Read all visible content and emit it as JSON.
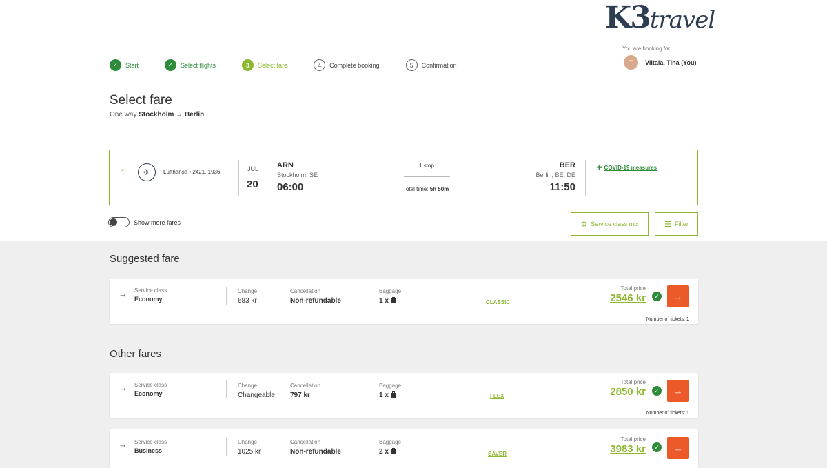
{
  "logo": {
    "k3": "K3",
    "travel": "travel"
  },
  "booking": {
    "label": "You are booking for:",
    "avatar_initial": "T",
    "user_name": "Viitala, Tina (You)"
  },
  "steps": [
    {
      "label": "Start",
      "state": "done",
      "marker": "✓"
    },
    {
      "label": "Select flights",
      "state": "done",
      "marker": "✓"
    },
    {
      "label": "Select fare",
      "state": "current",
      "marker": "3"
    },
    {
      "label": "Complete booking",
      "state": "todo",
      "marker": "4"
    },
    {
      "label": "Confirmation",
      "state": "todo",
      "marker": "5"
    }
  ],
  "page": {
    "title": "Select fare",
    "trip_type": "One way",
    "origin": "Stockholm",
    "arrow": "→",
    "destination": "Berlin"
  },
  "flight": {
    "airline": "Lufthansa • 2421, 1936",
    "month": "JUL",
    "day": "20",
    "dep_code": "ARN",
    "dep_city": "Stockholm, SE",
    "dep_time": "06:00",
    "stops": "1 stop",
    "total_time_label": "Total time:",
    "total_time": "5h 50m",
    "arr_code": "BER",
    "arr_city": "Berlin, BE, DE",
    "arr_time": "11:50",
    "covid_label": "COVID-19 measures"
  },
  "controls": {
    "show_more_fares": "Show more fares",
    "service_class_mix": "Service class mix",
    "filter": "Filter"
  },
  "labels": {
    "service_class": "Service class",
    "change": "Change",
    "cancellation": "Cancellation",
    "baggage": "Baggage",
    "total_price": "Total price",
    "tickets": "Number of tickets:"
  },
  "suggested": {
    "title": "Suggested fare",
    "fare": {
      "service_class": "Economy",
      "change": "683 kr",
      "cancellation": "Non-refundable",
      "baggage": "1 x",
      "fare_name": "CLASSIC",
      "price": "2546 kr",
      "tickets": "1"
    }
  },
  "other": {
    "title": "Other fares",
    "fares": [
      {
        "service_class": "Economy",
        "change": "Changeable",
        "cancellation": "797 kr",
        "baggage": "1 x",
        "fare_name": "FLEX",
        "price": "2850 kr",
        "tickets": "1"
      },
      {
        "service_class": "Business",
        "change": "1025 kr",
        "cancellation": "Non-refundable",
        "baggage": "2 x",
        "fare_name": "SAVER",
        "price": "3983 kr",
        "tickets": ""
      }
    ]
  },
  "colors": {
    "accent": "#8db830",
    "done": "#2e8b3a",
    "action": "#ec5a2a"
  }
}
